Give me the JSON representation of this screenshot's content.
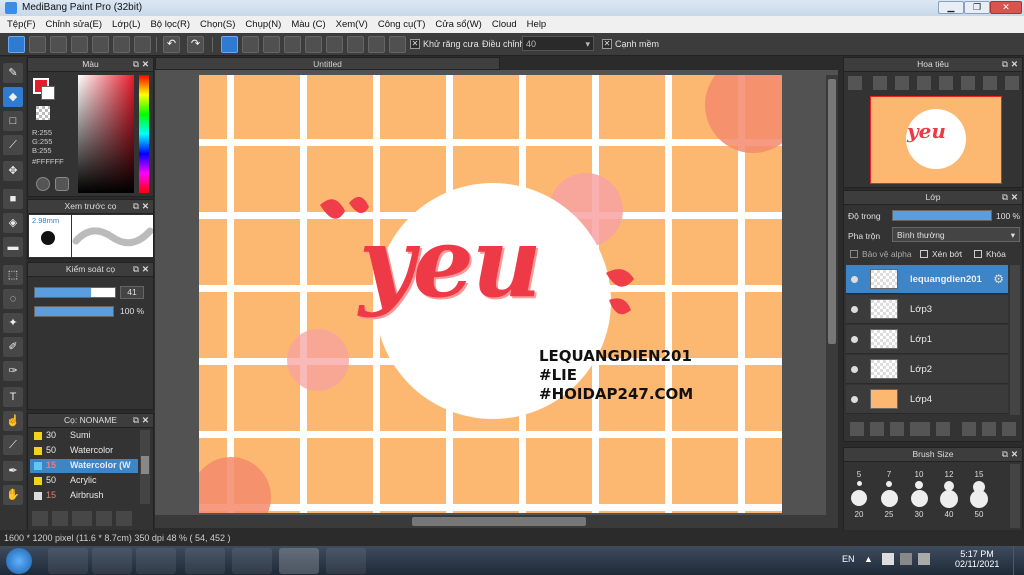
{
  "window": {
    "title": "MediBang Paint Pro (32bit)"
  },
  "menu": [
    "Tệp(F)",
    "Chỉnh sửa(E)",
    "Lớp(L)",
    "Bộ lọc(R)",
    "Chọn(S)",
    "Chụp(N)",
    "Màu (C)",
    "Xem(V)",
    "Công cụ(T)",
    "Cửa sổ(W)",
    "Cloud",
    "Help"
  ],
  "toolbar": {
    "antialias_label": "Khử răng cưa",
    "adjust_label": "Điều chỉnh",
    "adjust_value": "40",
    "edge_label": "Cạnh mềm"
  },
  "document": {
    "tab_title": "Untitled"
  },
  "color_panel": {
    "title": "Màu",
    "r": "R:255",
    "g": "G:255",
    "b": "B:255",
    "hex": "#FFFFFF",
    "primary_color": "#e81c2c"
  },
  "brush_preview": {
    "title": "Xem trước cọ",
    "size": "2.98mm"
  },
  "brush_control": {
    "title": "Kiểm soát cọ",
    "size_value": "41",
    "opacity_value": "100 %"
  },
  "brush_list": {
    "title": "Cọ: NONAME",
    "items": [
      {
        "size": "30",
        "name": "Sumi",
        "color": "#f2d21b"
      },
      {
        "size": "50",
        "name": "Watercolor",
        "color": "#f2d21b"
      },
      {
        "size": "15",
        "name": "Watercolor (W",
        "color": "#5ec8f0",
        "selected": true
      },
      {
        "size": "50",
        "name": "Acrylic",
        "color": "#f2d21b"
      },
      {
        "size": "15",
        "name": "Airbrush",
        "color": "#dddddd"
      }
    ]
  },
  "navigator": {
    "title": "Hoa tiêu"
  },
  "layer_panel": {
    "title": "Lớp",
    "opacity_label": "Độ trong",
    "opacity_value": "100 %",
    "opacity_fraction": 1.0,
    "blend_label": "Pha trộn",
    "blend_value": "Bình thường",
    "protect_alpha_label": "Bảo vệ alpha",
    "clip_label": "Xén bớt",
    "lock_label": "Khóa",
    "layers": [
      {
        "name": "lequangdien201",
        "selected": true
      },
      {
        "name": "Lớp3"
      },
      {
        "name": "Lớp1"
      },
      {
        "name": "Lớp2"
      },
      {
        "name": "Lớp4"
      }
    ]
  },
  "brush_size_panel": {
    "title": "Brush Size",
    "row1": [
      "5",
      "7",
      "10",
      "12",
      "15"
    ],
    "row2": [
      "20",
      "25",
      "30",
      "40",
      "50"
    ]
  },
  "artwork": {
    "word": "yeu",
    "line1": "LEQUANGDIEN201",
    "line2": "#LIE",
    "line3": "#HOIDAP247.COM"
  },
  "status": {
    "text": "1600 * 1200 pixel   (11.6 * 8.7cm)   350 dpi   48 %   ( 54, 452 )"
  },
  "taskbar": {
    "lang": "EN",
    "time": "5:17 PM",
    "date": "02/11/2021"
  }
}
